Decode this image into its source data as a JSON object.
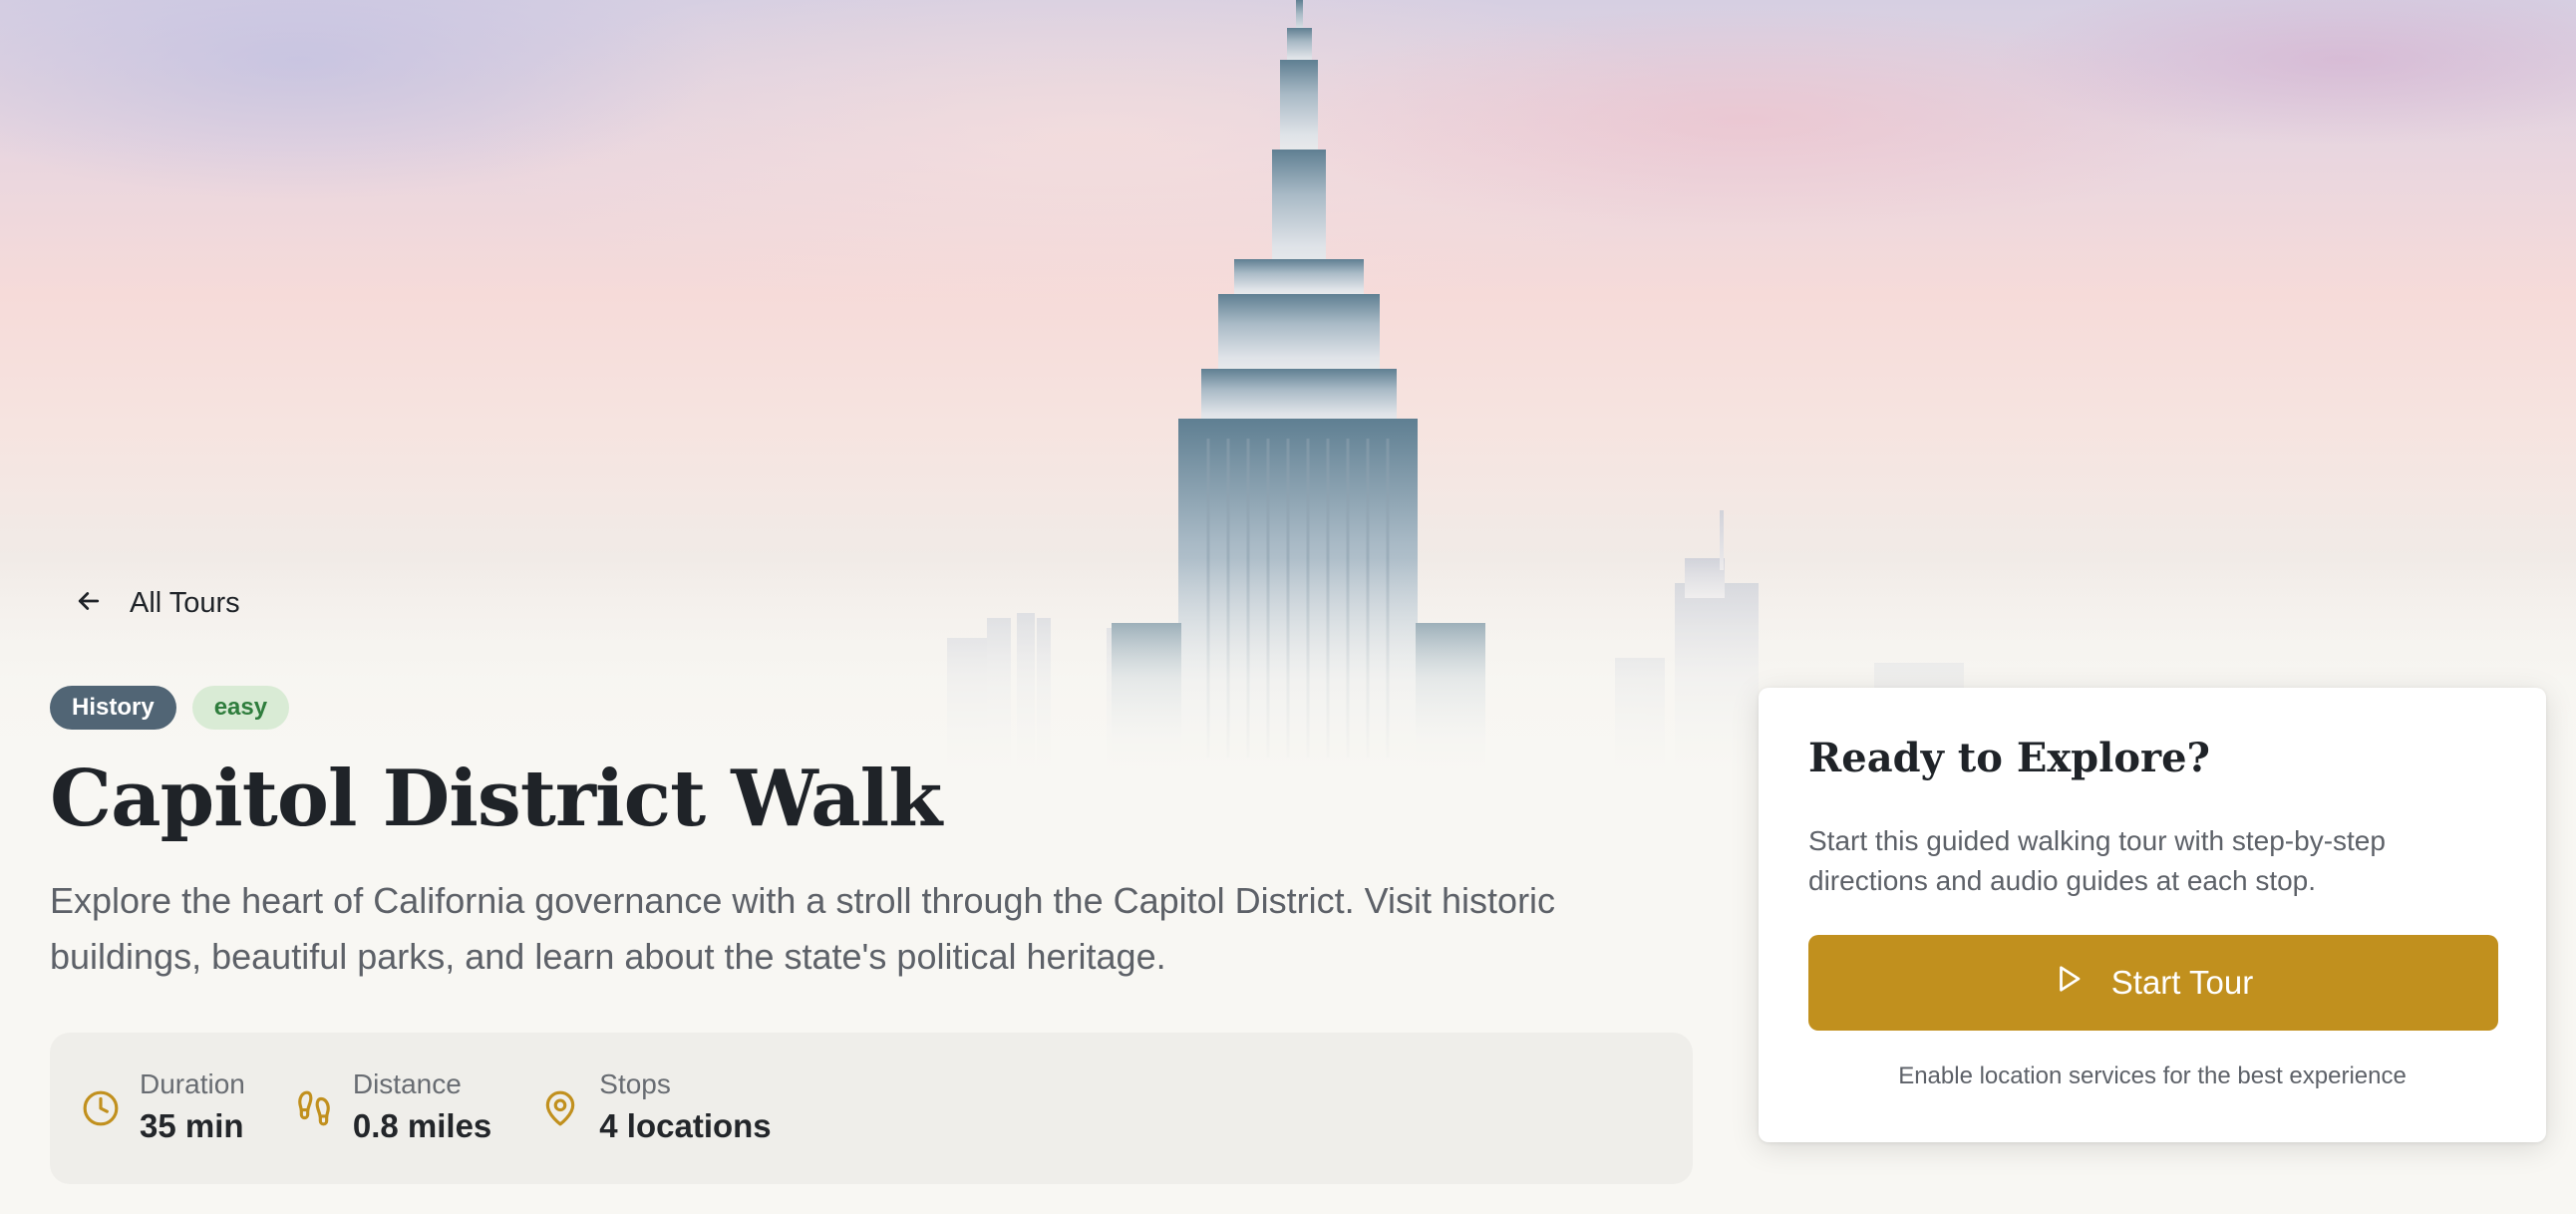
{
  "hero": {
    "image": "empire-state-building-skyline-at-dawn"
  },
  "nav": {
    "back_label": "All Tours",
    "back_icon": "arrow-left-icon"
  },
  "tour": {
    "tags": [
      {
        "label": "History",
        "bg": "#516575",
        "color": "#ffffff"
      },
      {
        "label": "easy",
        "bg": "#d9ebd5",
        "color": "#2f7d3d"
      }
    ],
    "title": "Capitol District Walk",
    "description": "Explore the heart of California governance with a stroll through the Capitol District. Visit historic buildings, beautiful parks, and learn about the state's political heritage.",
    "stats": [
      {
        "label": "Duration",
        "value": "35 min",
        "icon": "clock-icon"
      },
      {
        "label": "Distance",
        "value": "0.8 miles",
        "icon": "footprints-icon"
      },
      {
        "label": "Stops",
        "value": "4 locations",
        "icon": "map-pin-icon"
      }
    ]
  },
  "cta": {
    "title": "Ready to Explore?",
    "description": "Start this guided walking tour with step-by-step directions and audio guides at each stop.",
    "button_label": "Start Tour",
    "button_icon": "play-icon",
    "note": "Enable location services for the best experience"
  },
  "colors": {
    "accent": "#c1901e",
    "history_tag": "#516575",
    "easy_tag_bg": "#d9ebd5",
    "easy_tag_text": "#2f7d3d",
    "page_bg": "#f8f7f3"
  }
}
